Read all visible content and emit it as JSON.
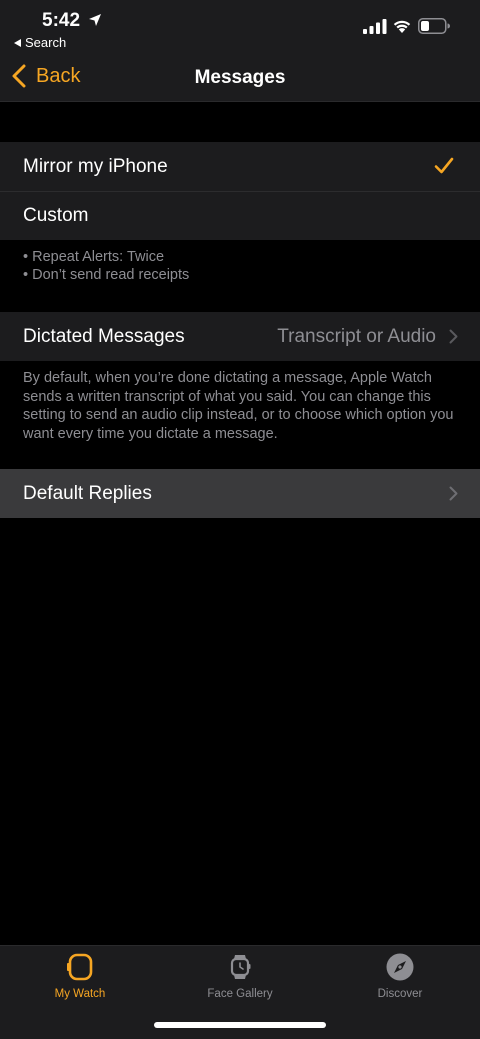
{
  "status": {
    "time": "5:42",
    "back_app": "Search"
  },
  "nav": {
    "back_label": "Back",
    "title": "Messages"
  },
  "alerts_group": {
    "options": [
      {
        "label": "Mirror my iPhone",
        "selected": true
      },
      {
        "label": "Custom",
        "selected": false
      }
    ],
    "notes": [
      "• Repeat Alerts: Twice",
      "• Don’t send read receipts"
    ]
  },
  "dictated": {
    "label": "Dictated Messages",
    "value": "Transcript or Audio",
    "description": "By default, when you’re done dictating a message, Apple Watch sends a written transcript of what you said. You can change this setting to send an audio clip instead, or to choose which option you want every time you dictate a message."
  },
  "replies": {
    "label": "Default Replies"
  },
  "tabs": [
    {
      "label": "My Watch",
      "icon": "watch-icon",
      "active": true
    },
    {
      "label": "Face Gallery",
      "icon": "face-gallery-icon",
      "active": false
    },
    {
      "label": "Discover",
      "icon": "compass-icon",
      "active": false
    }
  ],
  "colors": {
    "accent": "#f6a623",
    "background": "#000000",
    "cell": "#1c1c1e",
    "secondary_text": "#8e8e93"
  }
}
